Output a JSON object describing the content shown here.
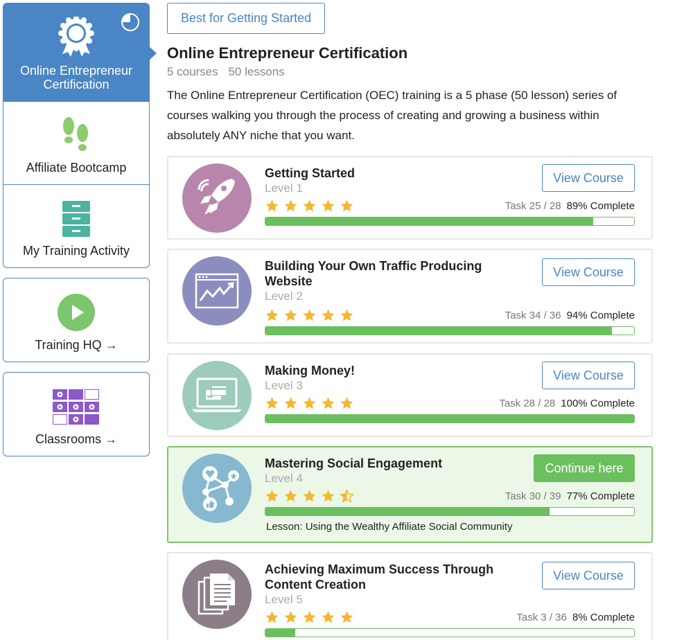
{
  "sidebar": {
    "items": [
      {
        "label": "Online Entrepreneur Certification",
        "icon": "award-badge-icon",
        "active": true
      },
      {
        "label": "Affiliate Bootcamp",
        "icon": "footprints-icon"
      },
      {
        "label": "My Training Activity",
        "icon": "filing-cabinet-icon"
      }
    ],
    "training_hq": {
      "label": "Training HQ →",
      "icon": "play-icon"
    },
    "classrooms": {
      "label": "Classrooms →",
      "icon": "grid-video-icon"
    }
  },
  "main": {
    "badge_label": "Best for Getting Started",
    "title": "Online Entrepreneur Certification",
    "courses_count": "5 courses",
    "lessons_count": "50 lessons",
    "description": "The Online Entrepreneur Certification (OEC) training is a 5 phase (50 lesson) series of courses walking you through the process of creating and growing a business within absolutely ANY niche that you want."
  },
  "courses": [
    {
      "name": "Getting Started",
      "level": "Level 1",
      "task": "Task 25 / 28",
      "complete": "89% Complete",
      "progress": 0.89,
      "stars": 5,
      "button": "View Course",
      "icon": "rocket-icon",
      "color": "#b886ad"
    },
    {
      "name": "Building Your Own Traffic Producing Website",
      "level": "Level 2",
      "task": "Task 34 / 36",
      "complete": "94% Complete",
      "progress": 0.94,
      "stars": 5,
      "button": "View Course",
      "icon": "website-graph-icon",
      "color": "#8b8dbf"
    },
    {
      "name": "Making Money!",
      "level": "Level 3",
      "task": "Task 28 / 28",
      "complete": "100% Complete",
      "progress": 1.0,
      "stars": 5,
      "button": "View Course",
      "icon": "laptop-card-icon",
      "color": "#9dcbbd"
    },
    {
      "name": "Mastering Social Engagement",
      "level": "Level 4",
      "task": "Task 30 / 39",
      "complete": "77% Complete",
      "progress": 0.77,
      "stars": 4.5,
      "button": "Continue here",
      "lesson": "Lesson: Using the Wealthy Affiliate Social Community",
      "icon": "social-network-icon",
      "color": "#86b8d0"
    },
    {
      "name": "Achieving Maximum Success Through Content Creation",
      "level": "Level 5",
      "task": "Task 3 / 36",
      "complete": "8% Complete",
      "progress": 0.08,
      "stars": 5,
      "button": "View Course",
      "icon": "documents-icon",
      "color": "#8c7d88"
    }
  ],
  "colors": {
    "accent": "#4a86c5",
    "success": "#6cbf5f",
    "star": "#f5b731",
    "highlight_bg": "#ebf8e8"
  }
}
